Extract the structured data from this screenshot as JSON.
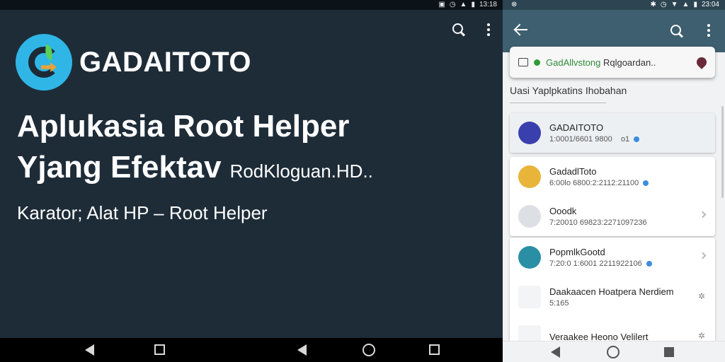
{
  "left": {
    "status_time": "13:18",
    "brand": "GADAITOTO",
    "headline_line1": "Aplukasia Root Helper",
    "headline_line2": "Yjang Efektav",
    "headline_sub": "RodKloguan.HD..",
    "tagline": "Karator; Alat HP – Root Helper"
  },
  "right": {
    "status_time": "23:04",
    "search": {
      "text_green": "GadAllvstong",
      "text_rest": "Rqlgoardan.."
    },
    "section_title": "Uasi Yaplpkatins Ihobahan",
    "items": [
      {
        "title": "GADAITOTO",
        "subtitle": "1:0001/6601 9800",
        "marker": "o1",
        "color": "#3a3fae",
        "highlight": true
      },
      {
        "title": "GadadlToto",
        "subtitle": "6:00lo 6800:2:2112:21100",
        "color": "#e8b43a"
      },
      {
        "title": "Ooodk",
        "subtitle": "7:20010 69823:2271097236",
        "color": "#dcdfe3"
      },
      {
        "title": "PopmlkGootd",
        "subtitle": "7:20:0 1:6001 2211922106",
        "color": "#2a8fa5"
      },
      {
        "title": "Daakaacen Hoatpera Nerdiem",
        "subtitle": "5:165",
        "color": "#f2f4f6"
      },
      {
        "title": "Veraakee Heono Velilert",
        "subtitle": "",
        "color": "#f2f4f6"
      }
    ]
  }
}
